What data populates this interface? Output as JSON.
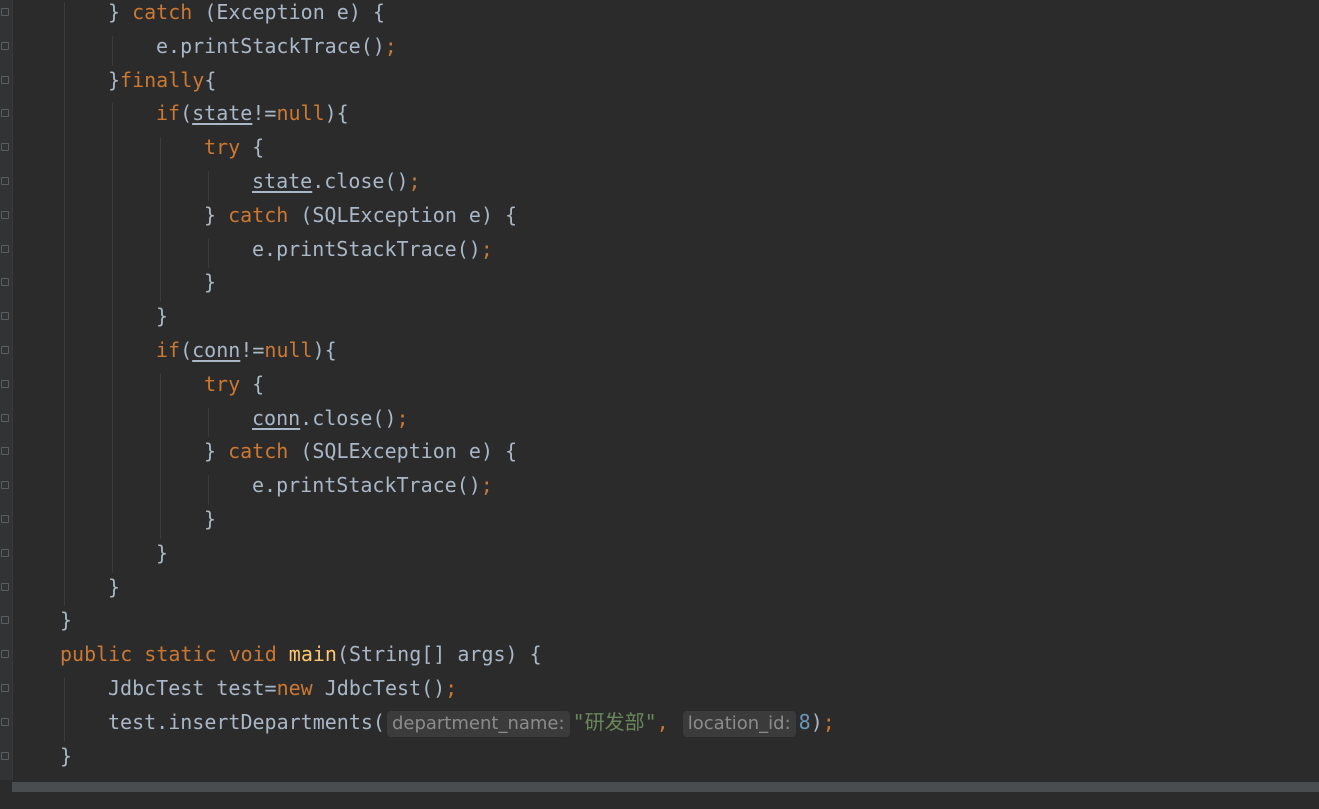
{
  "editor": {
    "language": "java",
    "colors": {
      "background": "#2b2b2b",
      "text": "#a9b7c6",
      "keyword": "#cc7832",
      "method": "#ffc66d",
      "number": "#6897bb",
      "string": "#6a8759",
      "hint_bg": "#3b3b3b",
      "hint_text": "#8c8c8c"
    },
    "lines": [
      {
        "indent": 2,
        "tokens": [
          {
            "t": "} ",
            "c": "plain"
          },
          {
            "t": "catch",
            "c": "kw"
          },
          {
            "t": " (Exception e) {",
            "c": "plain"
          }
        ]
      },
      {
        "indent": 3,
        "tokens": [
          {
            "t": "e.printStackTrace()",
            "c": "plain"
          },
          {
            "t": ";",
            "c": "kw"
          }
        ]
      },
      {
        "indent": 2,
        "tokens": [
          {
            "t": "}",
            "c": "plain"
          },
          {
            "t": "finally",
            "c": "kw"
          },
          {
            "t": "{",
            "c": "plain"
          }
        ]
      },
      {
        "indent": 3,
        "tokens": [
          {
            "t": "if",
            "c": "kw"
          },
          {
            "t": "(",
            "c": "plain"
          },
          {
            "t": "state",
            "c": "field"
          },
          {
            "t": "!=",
            "c": "plain"
          },
          {
            "t": "null",
            "c": "kw"
          },
          {
            "t": "){",
            "c": "plain"
          }
        ]
      },
      {
        "indent": 4,
        "tokens": [
          {
            "t": "try",
            "c": "kw"
          },
          {
            "t": " {",
            "c": "plain"
          }
        ]
      },
      {
        "indent": 5,
        "tokens": [
          {
            "t": "state",
            "c": "field"
          },
          {
            "t": ".close()",
            "c": "plain"
          },
          {
            "t": ";",
            "c": "kw"
          }
        ]
      },
      {
        "indent": 4,
        "tokens": [
          {
            "t": "} ",
            "c": "plain"
          },
          {
            "t": "catch",
            "c": "kw"
          },
          {
            "t": " (SQLException e) {",
            "c": "plain"
          }
        ]
      },
      {
        "indent": 5,
        "tokens": [
          {
            "t": "e.printStackTrace()",
            "c": "plain"
          },
          {
            "t": ";",
            "c": "kw"
          }
        ]
      },
      {
        "indent": 4,
        "tokens": [
          {
            "t": "}",
            "c": "plain"
          }
        ]
      },
      {
        "indent": 3,
        "tokens": [
          {
            "t": "}",
            "c": "plain"
          }
        ]
      },
      {
        "indent": 3,
        "tokens": [
          {
            "t": "if",
            "c": "kw"
          },
          {
            "t": "(",
            "c": "plain"
          },
          {
            "t": "conn",
            "c": "field"
          },
          {
            "t": "!=",
            "c": "plain"
          },
          {
            "t": "null",
            "c": "kw"
          },
          {
            "t": "){",
            "c": "plain"
          }
        ]
      },
      {
        "indent": 4,
        "tokens": [
          {
            "t": "try",
            "c": "kw"
          },
          {
            "t": " {",
            "c": "plain"
          }
        ]
      },
      {
        "indent": 5,
        "tokens": [
          {
            "t": "conn",
            "c": "field"
          },
          {
            "t": ".close()",
            "c": "plain"
          },
          {
            "t": ";",
            "c": "kw"
          }
        ]
      },
      {
        "indent": 4,
        "tokens": [
          {
            "t": "} ",
            "c": "plain"
          },
          {
            "t": "catch",
            "c": "kw"
          },
          {
            "t": " (SQLException e) {",
            "c": "plain"
          }
        ]
      },
      {
        "indent": 5,
        "tokens": [
          {
            "t": "e.printStackTrace()",
            "c": "plain"
          },
          {
            "t": ";",
            "c": "kw"
          }
        ]
      },
      {
        "indent": 4,
        "tokens": [
          {
            "t": "}",
            "c": "plain"
          }
        ]
      },
      {
        "indent": 3,
        "tokens": [
          {
            "t": "}",
            "c": "plain"
          }
        ]
      },
      {
        "indent": 2,
        "tokens": [
          {
            "t": "}",
            "c": "plain"
          }
        ]
      },
      {
        "indent": 1,
        "tokens": [
          {
            "t": "}",
            "c": "plain"
          }
        ]
      },
      {
        "indent": 1,
        "tokens": [
          {
            "t": "public static void ",
            "c": "kw"
          },
          {
            "t": "main",
            "c": "fn"
          },
          {
            "t": "(String[] args) {",
            "c": "plain"
          }
        ]
      },
      {
        "indent": 2,
        "tokens": [
          {
            "t": "JdbcTest test=",
            "c": "plain"
          },
          {
            "t": "new ",
            "c": "kw"
          },
          {
            "t": "JdbcTest()",
            "c": "plain"
          },
          {
            "t": ";",
            "c": "kw"
          }
        ]
      },
      {
        "indent": 2,
        "tokens": [
          {
            "t": "test.insertDepartments(",
            "c": "plain"
          },
          {
            "t": "department_name:",
            "c": "hint"
          },
          {
            "t": "\"研发部\"",
            "c": "str"
          },
          {
            "t": ", ",
            "c": "kw"
          },
          {
            "t": "location_id:",
            "c": "hint"
          },
          {
            "t": "8",
            "c": "num"
          },
          {
            "t": ")",
            "c": "plain"
          },
          {
            "t": ";",
            "c": "kw"
          }
        ]
      },
      {
        "indent": 1,
        "tokens": [
          {
            "t": "}",
            "c": "plain"
          }
        ]
      },
      {
        "indent": 0,
        "tokens": [
          {
            "t": "}",
            "c": "plain"
          }
        ]
      }
    ]
  }
}
